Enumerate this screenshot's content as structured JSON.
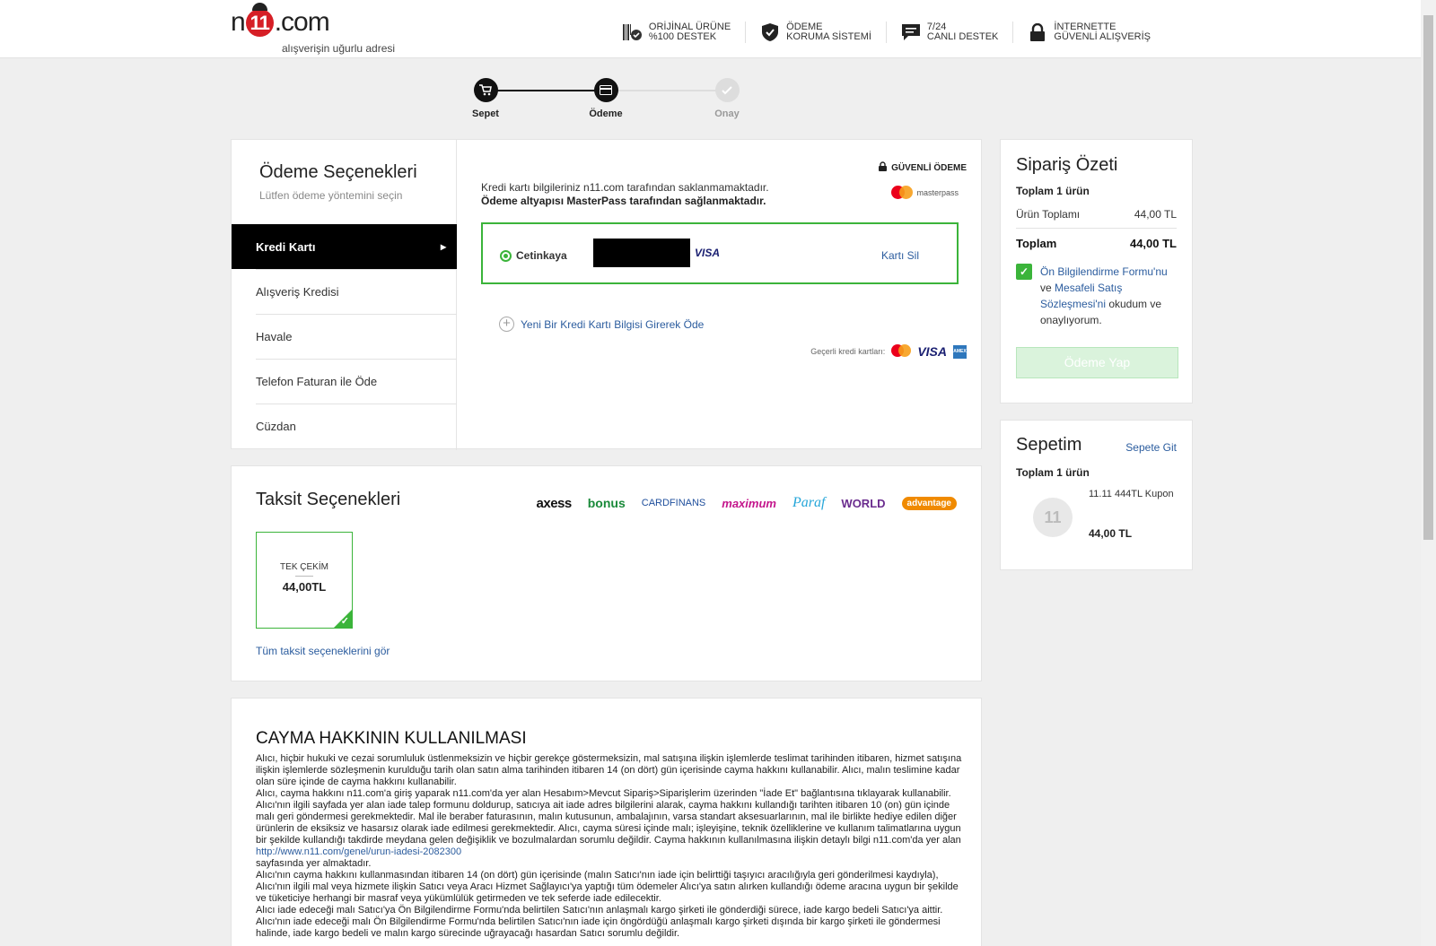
{
  "header": {
    "logo_text_left": "n",
    "logo_bug": "11",
    "logo_text_right": ".com",
    "slogan": "alışverişin uğurlu adresi",
    "badges": [
      {
        "line1": "ORİJİNAL ÜRÜNE",
        "line2": "%100 DESTEK",
        "icon": "barcode-check-icon"
      },
      {
        "line1": "ÖDEME",
        "line2": "KORUMA SİSTEMİ",
        "icon": "shield-check-icon"
      },
      {
        "line1": "7/24",
        "line2": "CANLI DESTEK",
        "icon": "chat-bubble-icon"
      },
      {
        "line1": "İNTERNETTE",
        "line2": "GÜVENLİ ALIŞVERİŞ",
        "icon": "lock-icon"
      }
    ]
  },
  "steps": [
    {
      "label": "Sepet",
      "icon": "cart-icon",
      "state": "done"
    },
    {
      "label": "Ödeme",
      "icon": "card-icon",
      "state": "active"
    },
    {
      "label": "Onay",
      "icon": "check-icon",
      "state": "pending"
    }
  ],
  "payment": {
    "title": "Ödeme Seçenekleri",
    "subtitle": "Lütfen ödeme yöntemini seçin",
    "methods": [
      "Kredi Kartı",
      "Alışveriş Kredisi",
      "Havale",
      "Telefon Faturan ile Öde",
      "Cüzdan"
    ],
    "secure_label": "GÜVENLİ ÖDEME",
    "info_line1": "Kredi kartı bilgileriniz n11.com tarafından saklanmamaktadır.",
    "info_line2": "Ödeme altyapısı MasterPass tarafından sağlanmaktadır.",
    "masterpass_text": "masterpass",
    "saved_card": {
      "owner": "Cetinkaya",
      "brand": "VISA",
      "delete_label": "Kartı Sil"
    },
    "new_card_label": "Yeni Bir Kredi Kartı Bilgisi Girerek Öde",
    "valid_cards_label": "Geçerli kredi kartları:",
    "valid_cards": [
      "mastercard",
      "VISA",
      "AMEX"
    ]
  },
  "installments": {
    "title": "Taksit Seçenekleri",
    "banks": [
      {
        "name": "axess",
        "color": "#111111"
      },
      {
        "name": "bonus",
        "color": "#1a8a3a"
      },
      {
        "name": "CARDFINANS",
        "color": "#1e4e9c"
      },
      {
        "name": "maximum",
        "color": "#c4168c"
      },
      {
        "name": "Paraf",
        "color": "#26a6d9"
      },
      {
        "name": "WORLD",
        "color": "#6a2c8e"
      },
      {
        "name": "advantage",
        "color": "#f08a00"
      }
    ],
    "single": {
      "label": "TEK ÇEKİM",
      "price": "44,00TL"
    },
    "all_link": "Tüm taksit seçeneklerini gör"
  },
  "legal": {
    "title": "CAYMA HAKKININ KULLANILMASI",
    "paragraphs": [
      "Alıcı, hiçbir hukuki ve cezai sorumluluk üstlenmeksizin ve hiçbir gerekçe göstermeksizin, mal satışına ilişkin işlemlerde teslimat tarihinden itibaren, hizmet satışına ilişkin işlemlerde sözleşmenin kurulduğu tarih olan satın alma tarihinden itibaren 14 (on dört) gün içerisinde cayma hakkını kullanabilir. Alıcı, malın teslimine kadar olan süre içinde de cayma hakkını kullanabilir.",
      "Alıcı, cayma hakkını n11.com'a giriş yaparak n11.com'da yer alan Hesabım>Mevcut Sipariş>Siparişlerim üzerinden \"İade Et\" bağlantısına tıklayarak kullanabilir. Alıcı'nın ilgili sayfada yer alan iade talep formunu doldurup, satıcıya ait iade adres bilgilerini alarak, cayma hakkını kullandığı tarihten itibaren 10 (on) gün içinde malı geri göndermesi gerekmektedir. Mal ile beraber faturasının, malın kutusunun, ambalajının, varsa standart aksesuarlarının, mal ile birlikte hediye edilen diğer ürünlerin de eksiksiz ve hasarsız olarak iade edilmesi gerekmektedir. Alıcı, cayma süresi içinde malı; işleyişine, teknik özelliklerine ve kullanım talimatlarına uygun bir şekilde kullandığı takdirde meydana gelen değişiklik ve bozulmalardan sorumlu değildir. Cayma hakkının kullanılmasına ilişkin detaylı bilgi n11.com'da yer alan"
    ],
    "link": "http://www.n11.com/genel/urun-iadesi-2082300",
    "after_link": "sayfasında yer almaktadır.",
    "paragraphs2": [
      "Alıcı'nın cayma hakkını kullanmasından itibaren 14 (on dört) gün içerisinde (malın Satıcı'nın iade için belirttiği taşıyıcı aracılığıyla geri gönderilmesi kaydıyla), Alıcı'nın ilgili mal veya hizmete ilişkin Satıcı veya Aracı Hizmet Sağlayıcı'ya yaptığı tüm ödemeler Alıcı'ya satın alırken kullandığı ödeme aracına uygun bir şekilde ve tüketiciye herhangi bir masraf veya yükümlülük getirmeden ve tek seferde iade edilecektir.",
      "Alıcı iade edeceği malı Satıcı'ya Ön Bilgilendirme Formu'nda belirtilen Satıcı'nın anlaşmalı kargo şirketi ile gönderdiği sürece, iade kargo bedeli Satıcı'ya aittir. Alıcı'nın iade edeceği malı Ön Bilgilendirme Formu'nda belirtilen Satıcı'nın iade için öngördüğü anlaşmalı kargo şirketi dışında bir kargo şirketi ile göndermesi halinde, iade kargo bedeli ve malın kargo sürecinde uğrayacağı hasardan Satıcı sorumlu değildir."
    ]
  },
  "summary": {
    "title": "Sipariş Özeti",
    "count": "Toplam 1 ürün",
    "subtotal_label": "Ürün Toplamı",
    "subtotal_value": "44,00 TL",
    "total_label": "Toplam",
    "total_value": "44,00 TL",
    "agree_link1": "Ön Bilgilendirme Formu'nu",
    "agree_mid": "ve",
    "agree_link2": "Mesafeli Satış Sözleşmesi'ni",
    "agree_end": "okudum ve onaylıyorum.",
    "pay_button": "Ödeme Yap"
  },
  "cart": {
    "title": "Sepetim",
    "go_link": "Sepete Git",
    "count": "Toplam 1 ürün",
    "item_name": "11.11 444TL Kupon",
    "item_price": "44,00 TL"
  }
}
